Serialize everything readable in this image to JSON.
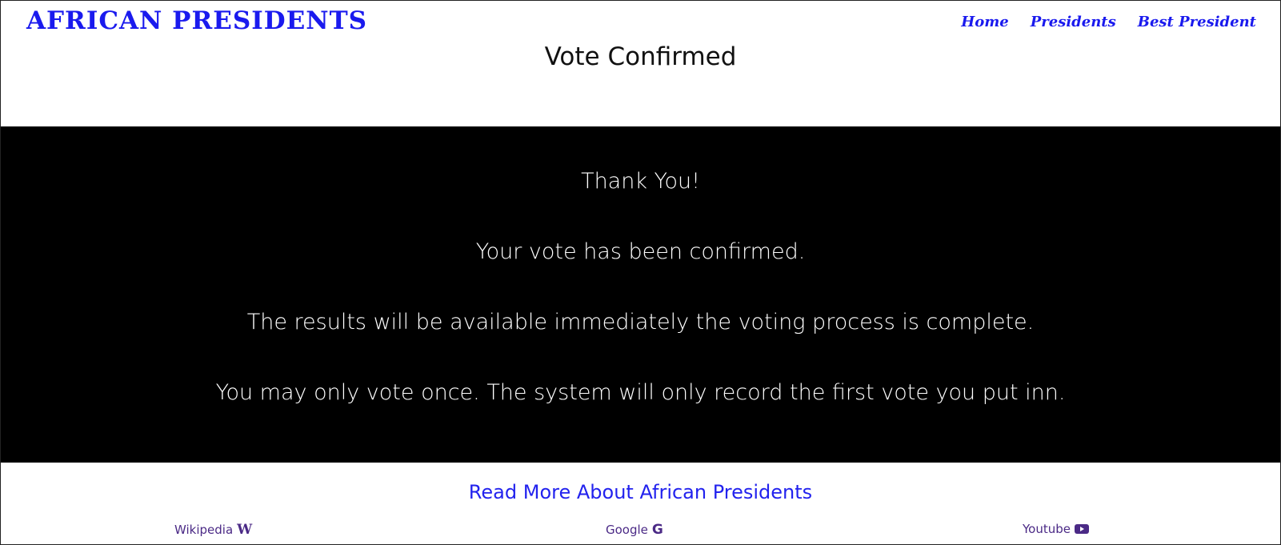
{
  "header": {
    "brand": "AFRICAN PRESIDENTS",
    "nav": [
      {
        "label": "Home"
      },
      {
        "label": "Presidents"
      },
      {
        "label": "Best President"
      }
    ]
  },
  "page": {
    "title": "Vote Confirmed"
  },
  "confirmation": {
    "heading": "Thank You!",
    "messages": [
      "Your vote has been confirmed.",
      "The results will be available immediately the voting process is complete.",
      "You may only vote once. The system will only record the first vote you put inn."
    ]
  },
  "footer": {
    "read_more": "Read More About African Presidents",
    "links": [
      {
        "label": "Wikipedia",
        "icon": "wikipedia-icon"
      },
      {
        "label": "Google",
        "icon": "google-icon"
      },
      {
        "label": "Youtube",
        "icon": "youtube-icon"
      }
    ]
  },
  "colors": {
    "brand_blue": "#1a1aee",
    "link_blue": "#2222ee",
    "footer_purple": "#4b2a86",
    "band_black": "#000000"
  }
}
